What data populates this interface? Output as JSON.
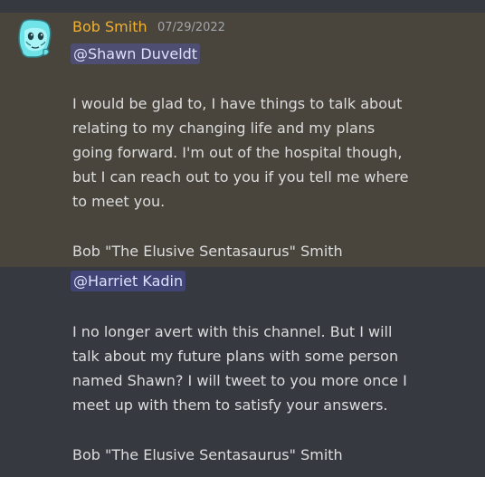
{
  "message_1": {
    "author": "Bob Smith",
    "timestamp": "07/29/2022",
    "mention": "@Shawn Duveldt",
    "lines": [
      "I would be glad to, I have things to talk about",
      "relating to my changing life and my plans",
      "going forward. I'm out of the hospital though,",
      "but I can reach out to you if you tell me where",
      "to meet you."
    ],
    "signature": "Bob \"The Elusive Sentasaurus\" Smith"
  },
  "message_2": {
    "mention": "@Harriet Kadin",
    "lines": [
      "I no longer avert with this channel. But I will",
      "talk about my future plans with some person",
      "named Shawn? I will tweet to you more once I",
      "meet up with them to satisfy your answers."
    ],
    "signature": "Bob \"The Elusive Sentasaurus\" Smith"
  },
  "colors": {
    "background": "#36393f",
    "highlight": "#49443c",
    "author": "#f0b132",
    "text": "#dcddde",
    "timestamp": "#a3a6aa",
    "mention_text": "#dee0fc",
    "avatar": "#6fe3e8"
  },
  "icons": {
    "avatar": "cartoon-avatar-icon"
  }
}
